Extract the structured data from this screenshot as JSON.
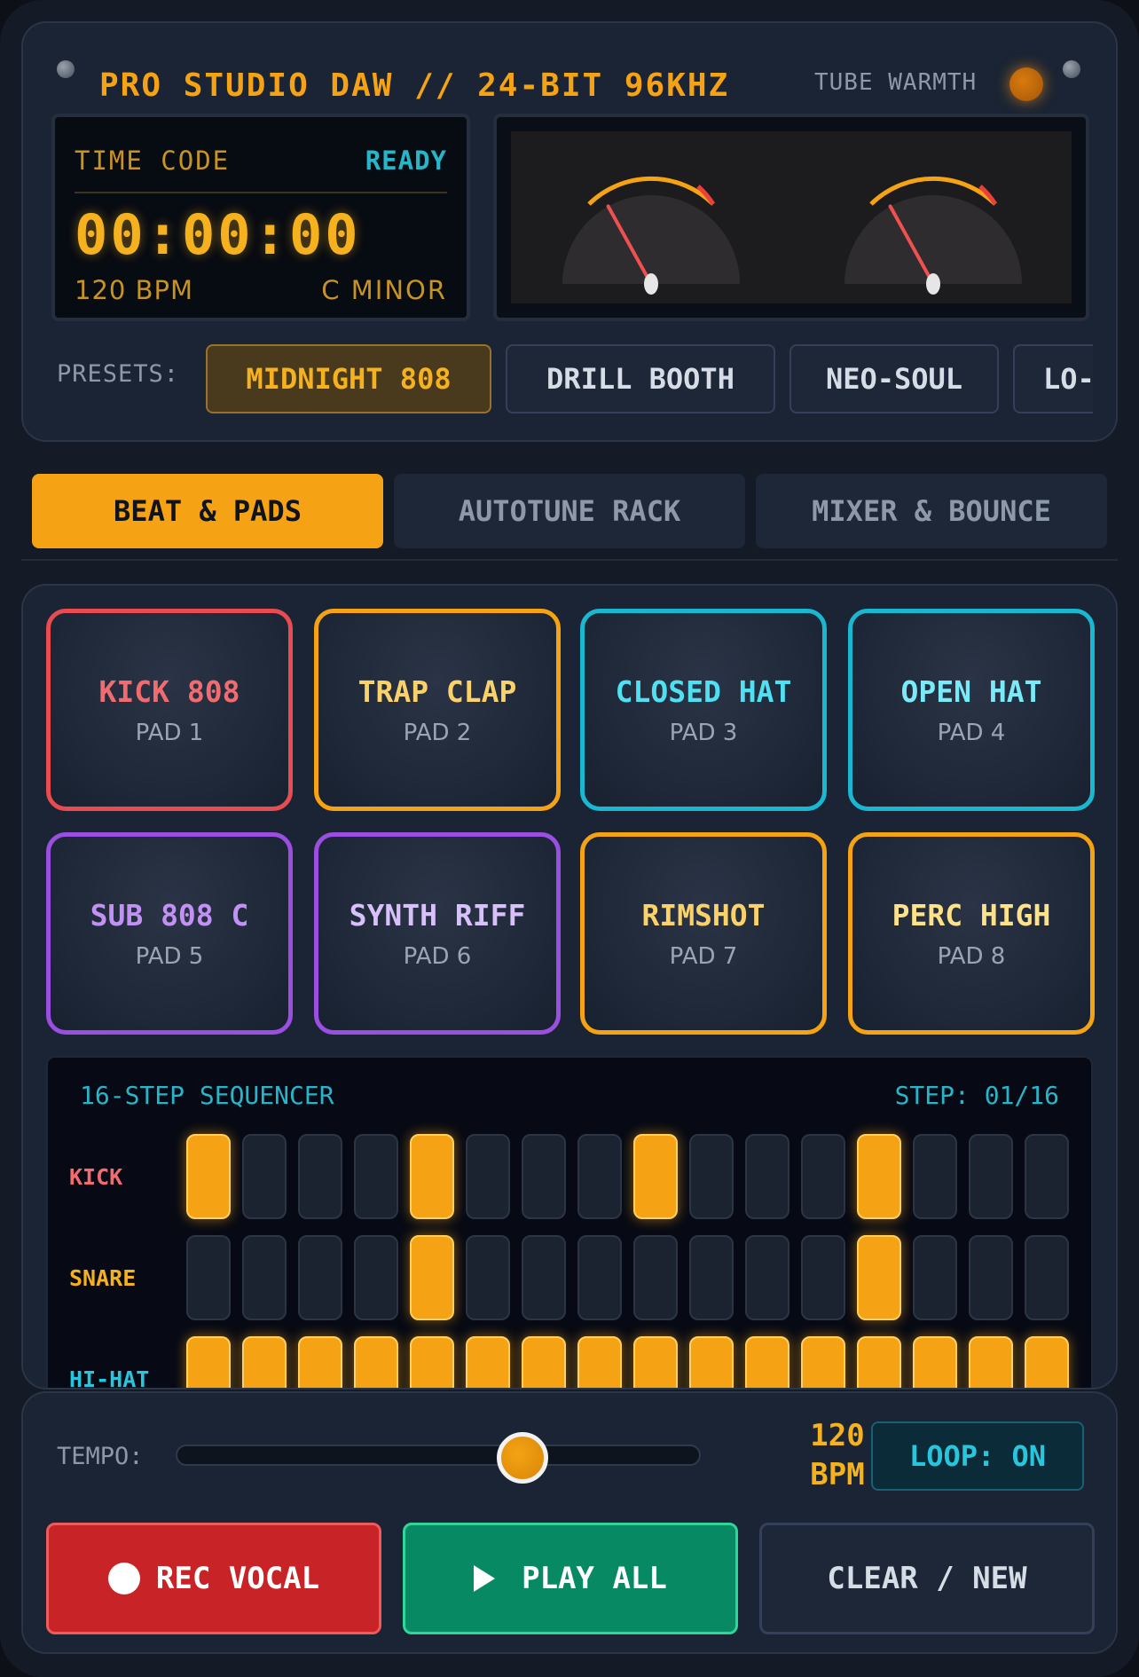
{
  "header": {
    "title": "PRO STUDIO DAW // 24-BIT 96KHZ",
    "warmth_label": "TUBE WARMTH"
  },
  "timecode": {
    "label": "TIME CODE",
    "status": "READY",
    "time": "00:00:00",
    "bpm": "120 BPM",
    "key": "C MINOR"
  },
  "meters": [
    {
      "needle_level": 0.2
    },
    {
      "needle_level": 0.2
    }
  ],
  "presets": {
    "label": "PRESETS:",
    "items": [
      {
        "label": "MIDNIGHT 808",
        "active": true
      },
      {
        "label": "DRILL BOOTH",
        "active": false
      },
      {
        "label": "NEO-SOUL",
        "active": false
      },
      {
        "label": "LO-",
        "active": false
      }
    ]
  },
  "tabs": [
    {
      "label": "BEAT & PADS",
      "active": true
    },
    {
      "label": "AUTOTUNE RACK",
      "active": false
    },
    {
      "label": "MIXER & BOUNCE",
      "active": false
    }
  ],
  "pads": [
    {
      "name": "KICK 808",
      "num": "PAD 1",
      "color": "#e84b50",
      "text_color": "#f26b6f"
    },
    {
      "name": "TRAP CLAP",
      "num": "PAD 2",
      "color": "#f5a314",
      "text_color": "#fbd26a"
    },
    {
      "name": "CLOSED HAT",
      "num": "PAD 3",
      "color": "#1bb6cf",
      "text_color": "#4fe0f2"
    },
    {
      "name": "OPEN HAT",
      "num": "PAD 4",
      "color": "#1bb6cf",
      "text_color": "#7aeaf8"
    },
    {
      "name": "SUB 808 C",
      "num": "PAD 5",
      "color": "#9b4fe0",
      "text_color": "#c391f5"
    },
    {
      "name": "SYNTH RIFF",
      "num": "PAD 6",
      "color": "#9b4fe0",
      "text_color": "#d8c0fa"
    },
    {
      "name": "RIMSHOT",
      "num": "PAD 7",
      "color": "#f5a314",
      "text_color": "#fbd26a"
    },
    {
      "name": "PERC HIGH",
      "num": "PAD 8",
      "color": "#f5a314",
      "text_color": "#fde28a"
    }
  ],
  "sequencer": {
    "title": "16-STEP SEQUENCER",
    "step": "STEP: 01/16",
    "rows": [
      {
        "label": "KICK",
        "color": "#f26b6f",
        "steps": [
          1,
          0,
          0,
          0,
          1,
          0,
          0,
          0,
          1,
          0,
          0,
          0,
          1,
          0,
          0,
          0
        ]
      },
      {
        "label": "SNARE",
        "color": "#f5b21e",
        "steps": [
          0,
          0,
          0,
          0,
          1,
          0,
          0,
          0,
          0,
          0,
          0,
          0,
          1,
          0,
          0,
          0
        ]
      },
      {
        "label": "HI-HAT",
        "color": "#27c6dc",
        "steps": [
          1,
          1,
          1,
          1,
          1,
          1,
          1,
          1,
          1,
          1,
          1,
          1,
          1,
          1,
          1,
          1
        ]
      }
    ]
  },
  "transport": {
    "tempo_label": "TEMPO:",
    "tempo_level": 0.66,
    "tempo_value": "120",
    "tempo_unit": "BPM",
    "loop_label": "LOOP: ON",
    "rec_label": "REC VOCAL",
    "play_label": "PLAY ALL",
    "clear_label": "CLEAR / NEW"
  }
}
